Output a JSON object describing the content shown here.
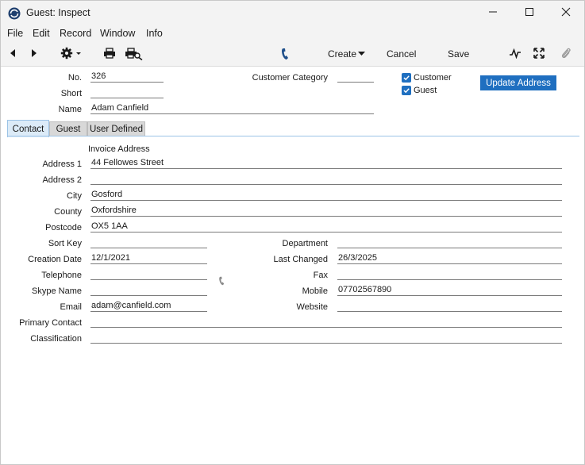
{
  "window": {
    "title": "Guest: Inspect"
  },
  "menu": {
    "items": [
      "File",
      "Edit",
      "Record",
      "Window",
      "Info"
    ]
  },
  "toolbar": {
    "create_label": "Create",
    "cancel_label": "Cancel",
    "save_label": "Save"
  },
  "header": {
    "no_label": "No.",
    "no_value": "326",
    "short_label": "Short",
    "short_value": "",
    "name_label": "Name",
    "name_value": "Adam Canfield",
    "category_label": "Customer Category",
    "category_value": "",
    "customer_label": "Customer",
    "customer_checked": true,
    "guest_label": "Guest",
    "guest_checked": true,
    "update_address_label": "Update Address"
  },
  "tabs": [
    {
      "label": "Contact",
      "active": true
    },
    {
      "label": "Guest",
      "active": false
    },
    {
      "label": "User Defined",
      "active": false
    }
  ],
  "contact": {
    "invoice_address_label": "Invoice Address",
    "address1_label": "Address 1",
    "address1_value": "44 Fellowes Street",
    "address2_label": "Address 2",
    "address2_value": "",
    "city_label": "City",
    "city_value": "Gosford",
    "county_label": "County",
    "county_value": "Oxfordshire",
    "postcode_label": "Postcode",
    "postcode_value": "OX5 1AA",
    "sortkey_label": "Sort Key",
    "sortkey_value": "",
    "creation_date_label": "Creation Date",
    "creation_date_value": "12/1/2021",
    "telephone_label": "Telephone",
    "telephone_value": "",
    "skype_label": "Skype Name",
    "skype_value": "",
    "email_label": "Email",
    "email_value": "adam@canfield.com",
    "primary_contact_label": "Primary Contact",
    "primary_contact_value": "",
    "classification_label": "Classification",
    "classification_value": "",
    "department_label": "Department",
    "department_value": "",
    "last_changed_label": "Last Changed",
    "last_changed_value": "26/3/2025",
    "fax_label": "Fax",
    "fax_value": "",
    "mobile_label": "Mobile",
    "mobile_value": "07702567890",
    "website_label": "Website",
    "website_value": ""
  },
  "icons": {
    "app": "app-logo-icon",
    "prev": "arrow-left-icon",
    "next": "arrow-right-icon",
    "settings": "gear-icon",
    "print": "printer-icon",
    "print_preview": "print-preview-icon",
    "phone": "phone-icon",
    "activity": "activity-icon",
    "expand": "expand-icon",
    "attach": "paperclip-icon"
  },
  "colors": {
    "accent": "#1f6fc0",
    "tab_active": "#dcebf8",
    "chrome": "#f3f3f3"
  }
}
